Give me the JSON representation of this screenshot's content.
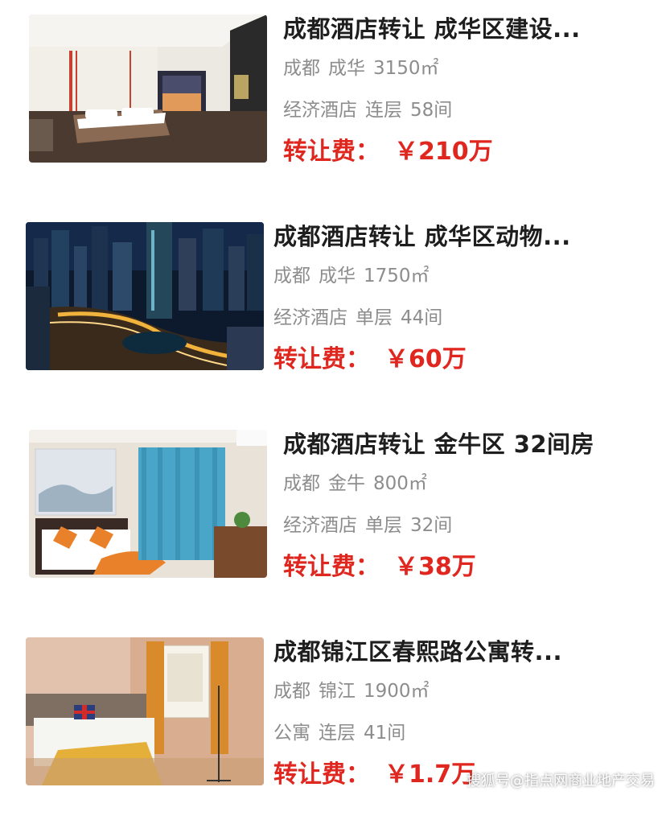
{
  "listings": [
    {
      "title": "成都酒店转让 成华区建设...",
      "city": "成都",
      "district": "成华",
      "area": "3150㎡",
      "type": "经济酒店",
      "floors": "连层",
      "rooms": "58间",
      "fee_label": "转让费：",
      "fee_value": "￥210万",
      "image": "hotel-room-photo"
    },
    {
      "title": "成都酒店转让 成华区动物...",
      "city": "成都",
      "district": "成华",
      "area": "1750㎡",
      "type": "经济酒店",
      "floors": "单层",
      "rooms": "44间",
      "fee_label": "转让费：",
      "fee_value": "￥60万",
      "image": "city-night-skyline-photo"
    },
    {
      "title": "成都酒店转让 金牛区 32间房",
      "city": "成都",
      "district": "金牛",
      "area": "800㎡",
      "type": "经济酒店",
      "floors": "单层",
      "rooms": "32间",
      "fee_label": "转让费：",
      "fee_value": "￥38万",
      "image": "hotel-room-blue-curtain-photo"
    },
    {
      "title": "成都锦江区春熙路公寓转...",
      "city": "成都",
      "district": "锦江",
      "area": "1900㎡",
      "type": "公寓",
      "floors": "连层",
      "rooms": "41间",
      "fee_label": "转让费：",
      "fee_value": "￥1.7万",
      "image": "apartment-bedroom-photo"
    }
  ],
  "watermark": "搜狐号@指点网商业地产交易",
  "colors": {
    "title": "#1e1e1e",
    "meta": "#8d8d8d",
    "price": "#e0271f"
  }
}
